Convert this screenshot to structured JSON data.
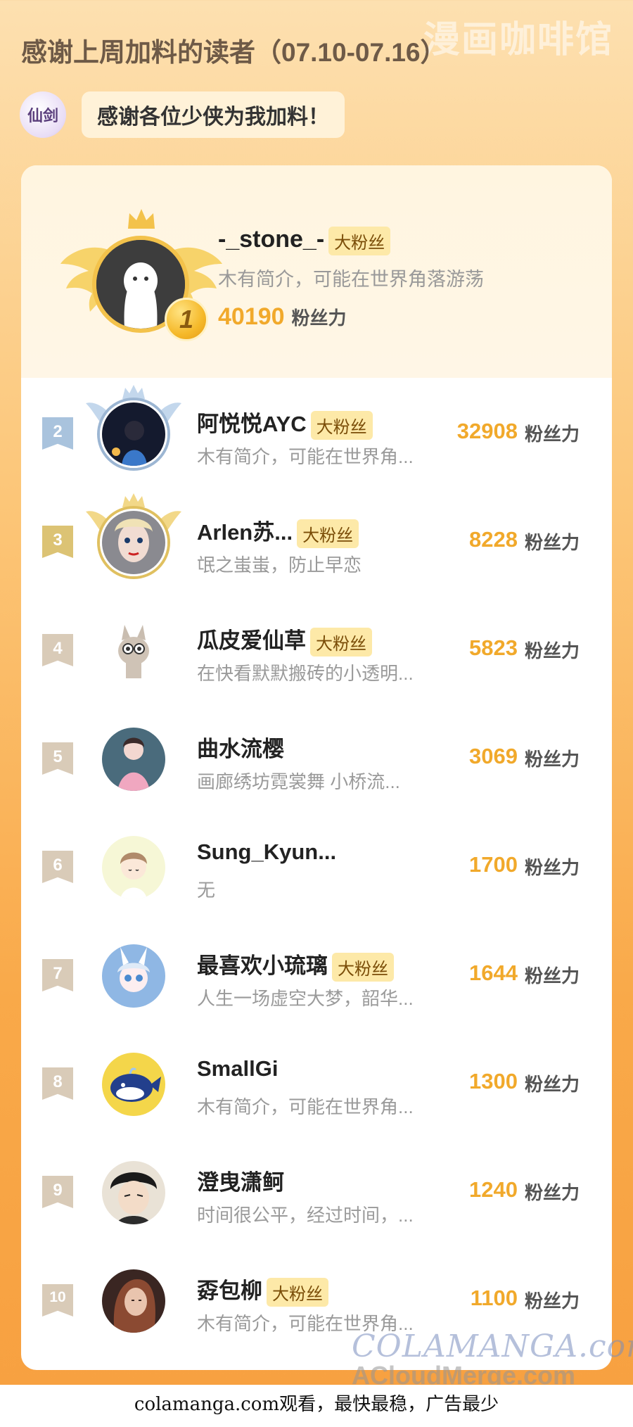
{
  "watermark_top": "漫画咖啡馆",
  "header": {
    "title": "感谢上周加料的读者（07.10-07.16）"
  },
  "logo": {
    "text": "仙剑"
  },
  "bubble": {
    "text": "感谢各位少侠为我加料！"
  },
  "top_reader": {
    "rank": "1",
    "name": "-_stone_-",
    "tag": "大粉丝",
    "bio": "木有简介，可能在世界角落游荡",
    "score": "40190",
    "unit": "粉丝力"
  },
  "readers": [
    {
      "rank": "2",
      "name": "阿悦悦AYC",
      "tag": "大粉丝",
      "bio": "木有简介，可能在世界角...",
      "score": "32908",
      "unit": "粉丝力"
    },
    {
      "rank": "3",
      "name": "Arlen苏...",
      "tag": "大粉丝",
      "bio": "氓之蚩蚩，防止早恋",
      "score": "8228",
      "unit": "粉丝力"
    },
    {
      "rank": "4",
      "name": "瓜皮爱仙草",
      "tag": "大粉丝",
      "bio": "在快看默默搬砖的小透明...",
      "score": "5823",
      "unit": "粉丝力"
    },
    {
      "rank": "5",
      "name": "曲水流樱",
      "tag": "",
      "bio": "画廊绣坊霓裳舞 小桥流...",
      "score": "3069",
      "unit": "粉丝力"
    },
    {
      "rank": "6",
      "name": "Sung_Kyun...",
      "tag": "",
      "bio": "无",
      "score": "1700",
      "unit": "粉丝力"
    },
    {
      "rank": "7",
      "name": "最喜欢小琉璃",
      "tag": "大粉丝",
      "bio": "人生一场虚空大梦，韶华...",
      "score": "1644",
      "unit": "粉丝力"
    },
    {
      "rank": "8",
      "name": "SmallGi",
      "tag": "",
      "bio": "木有简介，可能在世界角...",
      "score": "1300",
      "unit": "粉丝力"
    },
    {
      "rank": "9",
      "name": "澄曳潇鲄",
      "tag": "",
      "bio": "时间很公平，经过时间，...",
      "score": "1240",
      "unit": "粉丝力"
    },
    {
      "rank": "10",
      "name": "孬包柳",
      "tag": "大粉丝",
      "bio": "木有简介，可能在世界角...",
      "score": "1100",
      "unit": "粉丝力"
    }
  ],
  "footer": {
    "watermark1": "COLAMANGA.com",
    "watermark2": "ACloudMerge.com",
    "text": "colamanga.com观看，最快最稳，广告最少"
  },
  "colors": {
    "accent": "#f1a92b",
    "tag_bg": "#fde9a8"
  }
}
